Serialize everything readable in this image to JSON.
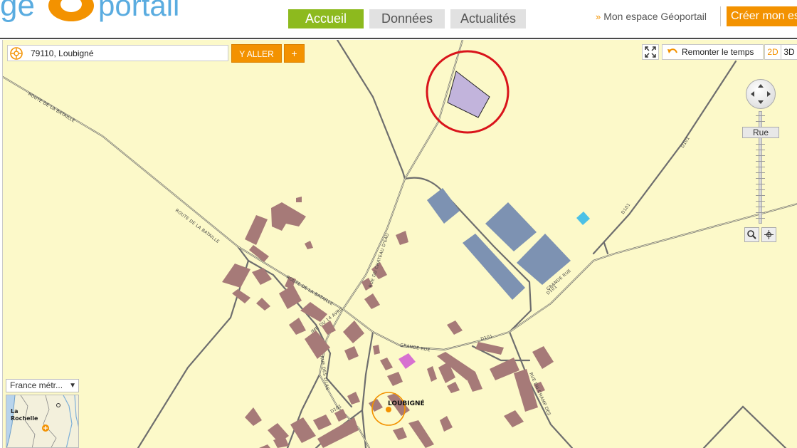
{
  "header": {
    "logo_left": "ge",
    "logo_right": "portail",
    "tabs": [
      {
        "label": "Accueil",
        "active": true
      },
      {
        "label": "Données",
        "active": false
      },
      {
        "label": "Actualités",
        "active": false
      }
    ],
    "espace_arrow": "»",
    "espace_label": "Mon espace Géoportail",
    "create_label": "Créer mon es"
  },
  "search": {
    "value": "79110, Loubigné",
    "go_label": "Y ALLER",
    "plus_label": "+"
  },
  "tools": {
    "time_label": "Remonter le temps",
    "mode_2d": "2D",
    "mode_3d": "3D"
  },
  "navigation": {
    "zoom_level_label": "Rue"
  },
  "map": {
    "place_name": "LOUBIGNÉ",
    "road_labels": {
      "bataille_west": "ROUTE DE LA BATAILLE",
      "bataille_mid": "ROUTE DE LA BATAILLE",
      "bataille_east": "ROUTE DE LA BATAILLE",
      "chateau": "RUE DU CHATEAU D'EAU",
      "grande_rue_a": "GRANDE RUE",
      "grande_rue_b": "GRANDE RUE",
      "d101_a": "D101",
      "d101_b": "D101",
      "d101_c": "D101",
      "d101_d": "D101",
      "d101_e": "D101",
      "impasse": "IMP. DU 14 AVRIL",
      "lilas": "RUE DES LILAS",
      "champ": "RUE DU CHAMP DES"
    }
  },
  "overview": {
    "select_label": "France métr...",
    "arrow": "▼",
    "town_label": "La Rochelle"
  },
  "colors": {
    "accent_orange": "#f39200",
    "active_tab_green": "#8dba1e",
    "map_background": "#fcf9c9",
    "building": "#a67a78",
    "industrial": "#7d92b2",
    "highlight_parcel": "#c2b4dc",
    "annotation_circle": "#d9141b"
  }
}
